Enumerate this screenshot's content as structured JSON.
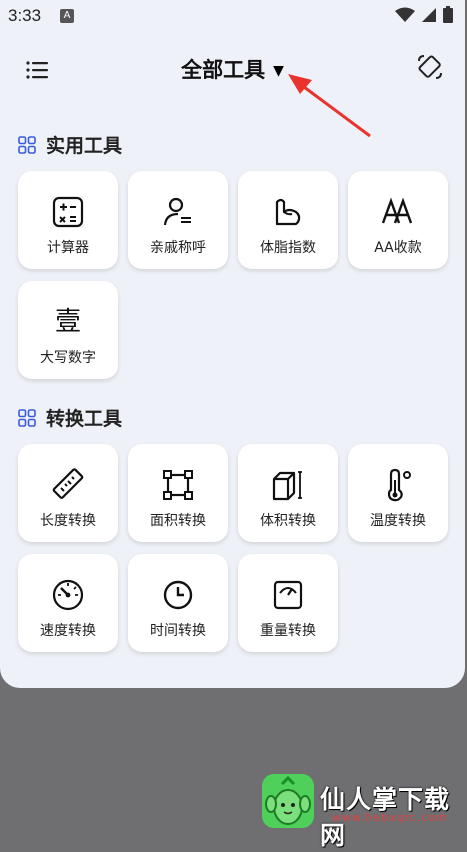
{
  "status_bar": {
    "time": "3:33",
    "app_letter": "A"
  },
  "header": {
    "title": "全部工具",
    "caret": "▼"
  },
  "sections": [
    {
      "title": "实用工具"
    },
    {
      "title": "转换工具"
    }
  ],
  "utility_tools": [
    {
      "label": "计算器",
      "icon": "calculator-icon"
    },
    {
      "label": "亲戚称呼",
      "icon": "person-list-icon"
    },
    {
      "label": "体脂指数",
      "icon": "arm-muscle-icon"
    },
    {
      "label": "AA收款",
      "icon": "aa-letters-icon"
    },
    {
      "label": "大写数字",
      "icon": "uppercase-number-icon",
      "glyph": "壹"
    }
  ],
  "conversion_tools": [
    {
      "label": "长度转换",
      "icon": "ruler-icon"
    },
    {
      "label": "面积转换",
      "icon": "area-square-icon"
    },
    {
      "label": "体积转换",
      "icon": "cube-icon"
    },
    {
      "label": "温度转换",
      "icon": "thermometer-icon"
    },
    {
      "label": "速度转换",
      "icon": "speedometer-icon"
    },
    {
      "label": "时间转换",
      "icon": "clock-icon"
    },
    {
      "label": "重量转换",
      "icon": "scale-icon"
    }
  ],
  "watermark": {
    "text": "仙人掌下载网",
    "url": "www.hebxqrc.com"
  },
  "colors": {
    "accent": "#3b5bdb",
    "arrow": "#e8332e",
    "background": "#eef1f7",
    "tile": "#ffffff"
  }
}
